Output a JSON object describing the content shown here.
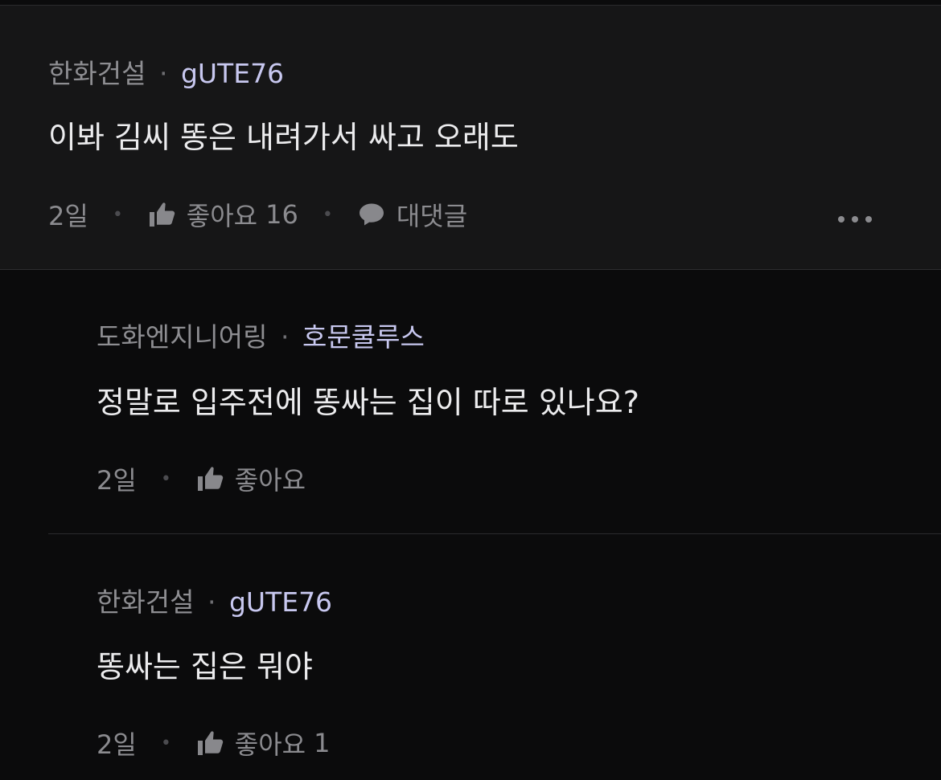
{
  "comments": [
    {
      "company": "한화건설",
      "separator": "·",
      "nickname": "gUTE76",
      "text": "이봐 김씨 똥은 내려가서 싸고 오래도",
      "date": "2일",
      "like_label": "좋아요",
      "like_count": "16",
      "reply_label": "대댓글"
    },
    {
      "company": "도화엔지니어링",
      "separator": "·",
      "nickname": "호문쿨루스",
      "text": "정말로 입주전에 똥싸는 집이 따로 있나요?",
      "date": "2일",
      "like_label": "좋아요"
    },
    {
      "company": "한화건설",
      "separator": "·",
      "nickname": "gUTE76",
      "text": "똥싸는 집은 뭐야",
      "date": "2일",
      "like_label": "좋아요",
      "like_count": "1"
    }
  ],
  "icons": {
    "like": "thumbs-up-icon",
    "reply": "speech-bubble-icon",
    "more": "more-horizontal-icon"
  },
  "colors": {
    "background": "#0b0b0c",
    "main_comment_background": "#161617",
    "nickname": "#c8c8f0",
    "muted_text": "#8b8b8f"
  }
}
